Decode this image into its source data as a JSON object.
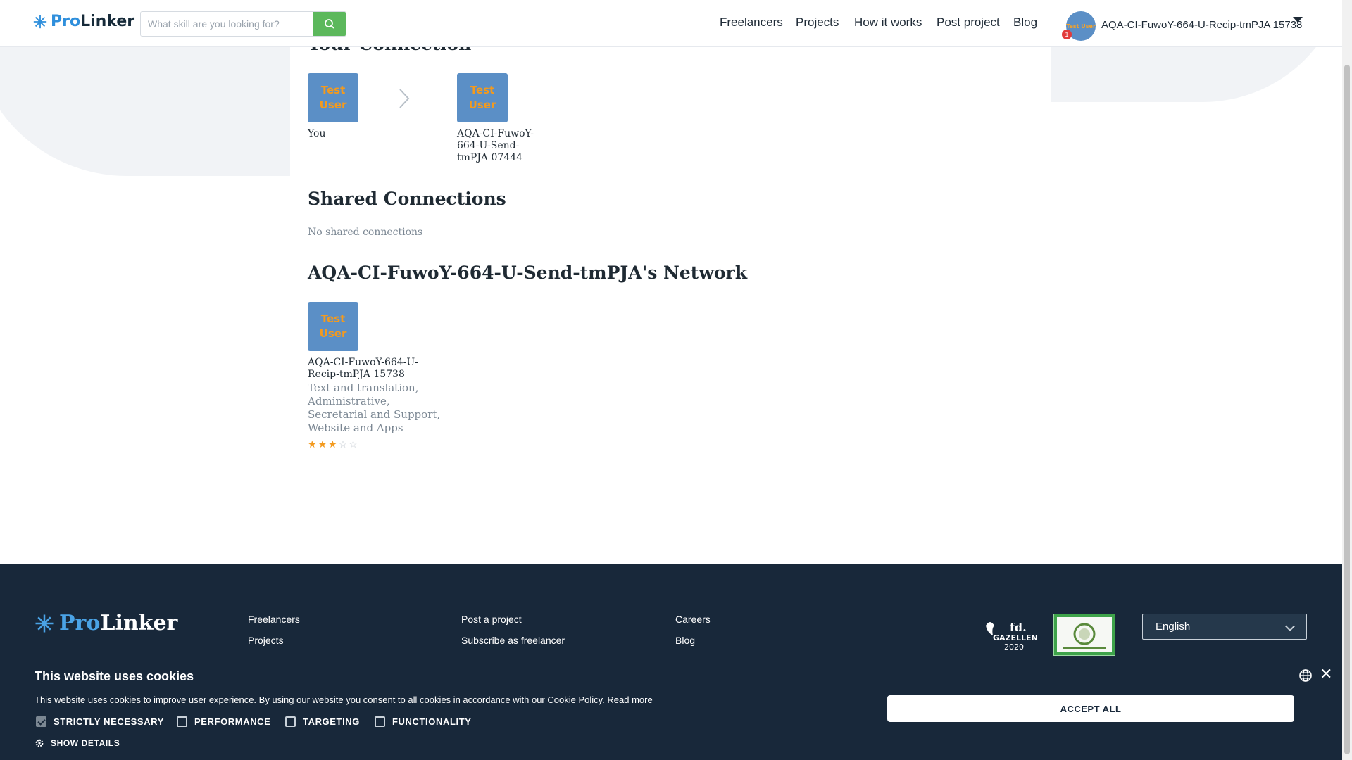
{
  "header": {
    "logo_pro": "Pro",
    "logo_linker": "Linker",
    "search_placeholder": "What skill are you looking for?",
    "nav": [
      "Freelancers",
      "Projects",
      "How it works",
      "Post project",
      "Blog"
    ],
    "notification_count": "1",
    "avatar_text": "Test User",
    "user_name": "AQA-CI-FuwoY-664-U-Recip-tmPJA 15738"
  },
  "main": {
    "your_connection_title": "Your Connection",
    "you_tile_text": "Test User",
    "you_label": "You",
    "target_tile_text": "Test User",
    "target_label": "AQA-CI-FuwoY-664-U-Send-tmPJA 07444",
    "shared_title": "Shared Connections",
    "shared_empty": "No shared connections",
    "network_title": "AQA-CI-FuwoY-664-U-Send-tmPJA's Network",
    "network_members": [
      {
        "tile_text": "Test User",
        "name": "AQA-CI-FuwoY-664-U-Recip-tmPJA 15738",
        "skills": "Text and translation, Administrative, Secretarial and Support, Website and Apps",
        "rating": 3,
        "rating_max": 5
      }
    ]
  },
  "footer": {
    "logo_pro": "Pro",
    "logo_linker": "Linker",
    "col1": [
      "Freelancers",
      "Projects"
    ],
    "col2": [
      "Post a project",
      "Subscribe as freelancer"
    ],
    "col3": [
      "Careers",
      "Blog"
    ],
    "award1_text": "fd. GAZELLEN 2020",
    "language": "English"
  },
  "cookie": {
    "title": "This website uses cookies",
    "text": "This website uses cookies to improve user experience. By using our website you consent to all cookies in accordance with our Cookie Policy.",
    "read_more": "Read more",
    "options": [
      {
        "label": "STRICTLY NECESSARY",
        "checked": true
      },
      {
        "label": "PERFORMANCE",
        "checked": false
      },
      {
        "label": "TARGETING",
        "checked": false
      },
      {
        "label": "FUNCTIONALITY",
        "checked": false
      }
    ],
    "show_details": "SHOW DETAILS",
    "accept_all": "ACCEPT ALL"
  },
  "colors": {
    "brand_blue": "#2f8fdc",
    "footer_bg": "#18283a",
    "tile_bg": "#5b8fc6",
    "tile_text": "#f39a1e",
    "search_btn": "#5cb85c",
    "badge": "#e23b3b"
  }
}
